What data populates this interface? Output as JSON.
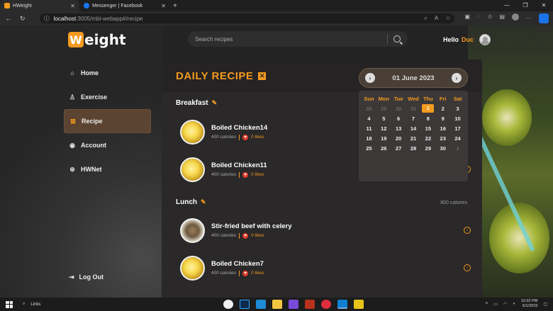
{
  "browser": {
    "tabs": [
      {
        "title": "HWeight",
        "active": true
      },
      {
        "title": "Messenger | Facebook",
        "active": false
      }
    ],
    "url_host": "localhost",
    "url_path": ":3005/mbi-webapp#/recipe"
  },
  "header": {
    "logo_w": "W",
    "logo_rest": "eight",
    "search_placeholder": "Search recipes",
    "greeting": "Hello",
    "user_name": "Duc"
  },
  "sidebar": {
    "items": [
      {
        "label": "Home",
        "icon": "home-icon",
        "active": false
      },
      {
        "label": "Exercise",
        "icon": "person-walk-icon",
        "active": false
      },
      {
        "label": "Recipe",
        "icon": "recipe-icon",
        "active": true
      },
      {
        "label": "Account",
        "icon": "user-circle-icon",
        "active": false
      },
      {
        "label": "HWNet",
        "icon": "network-icon",
        "active": false
      }
    ],
    "logout": "Log Out"
  },
  "main": {
    "title": "DAILY RECIPE",
    "date": "01 June 2023",
    "sections": [
      {
        "title": "Breakfast",
        "calories": "",
        "recipes": [
          {
            "name": "Boiled Chicken14",
            "calories": "400 calories",
            "likes": "0 likes"
          },
          {
            "name": "Boiled Chicken11",
            "calories": "400 calories",
            "likes": "0 likes"
          }
        ]
      },
      {
        "title": "Lunch",
        "calories": "800 calories",
        "recipes": [
          {
            "name": "Stir-fried beef with celery",
            "calories": "400 calories",
            "likes": "0 likes"
          },
          {
            "name": "Boiled Chicken7",
            "calories": "400 calories",
            "likes": "0 likes"
          }
        ]
      }
    ]
  },
  "calendar": {
    "weekdays": [
      "Sun",
      "Mon",
      "Tue",
      "Wed",
      "Thu",
      "Fri",
      "Sat"
    ],
    "weeks": [
      [
        "28",
        "29",
        "30",
        "31",
        "1",
        "2",
        "3"
      ],
      [
        "4",
        "5",
        "6",
        "7",
        "8",
        "9",
        "10"
      ],
      [
        "11",
        "12",
        "13",
        "14",
        "15",
        "16",
        "17"
      ],
      [
        "18",
        "19",
        "20",
        "21",
        "22",
        "23",
        "24"
      ],
      [
        "25",
        "26",
        "27",
        "28",
        "29",
        "30",
        "1"
      ]
    ],
    "selected": "1",
    "accent": "#f39a1f"
  },
  "taskbar": {
    "search_label": "Links",
    "time": "10:32 PM",
    "date": "6/1/2023"
  }
}
